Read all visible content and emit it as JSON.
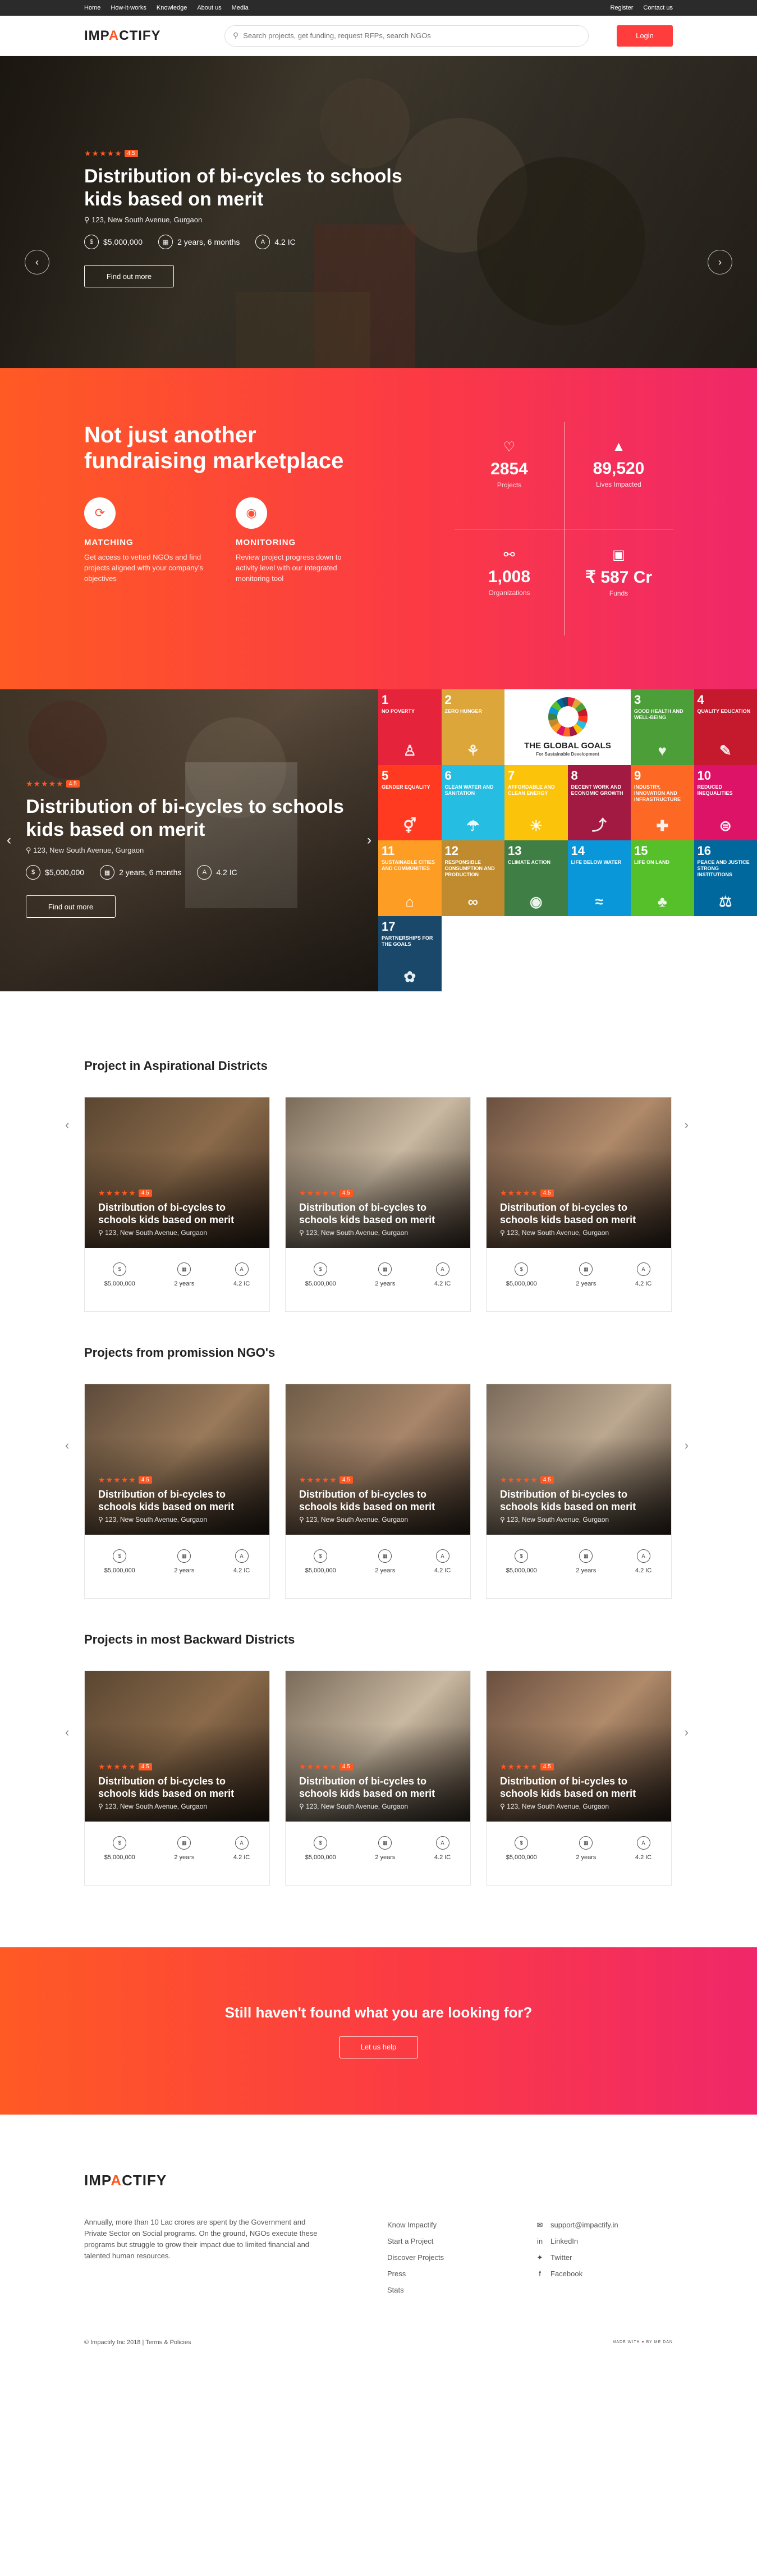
{
  "topbar": {
    "left": [
      "Home",
      "How-it-works",
      "Knowledge",
      "About us",
      "Media"
    ],
    "right": [
      "Register",
      "Contact us"
    ]
  },
  "header": {
    "logo_pre": "IMP",
    "logo_accent": "A",
    "logo_post": "CTIFY",
    "search_placeholder": "Search projects, get funding, request RFPs, search NGOs",
    "login_label": "Login"
  },
  "hero": {
    "rating": "4.5",
    "stars": "★★★★★",
    "title": "Distribution of bi-cycles to schools kids based on merit",
    "location": "123, New South Avenue, Gurgaon",
    "budget": "$5,000,000",
    "duration": "2 years, 6 months",
    "ic": "4.2 IC",
    "cta": "Find out more"
  },
  "marketplace": {
    "title": "Not just another fundraising marketplace",
    "features": [
      {
        "title": "MATCHING",
        "desc": "Get access to vetted NGOs and find projects aligned with your company's objectives"
      },
      {
        "title": "MONITORING",
        "desc": "Review project progress down to activity level with our integrated monitoring tool"
      }
    ],
    "stats": [
      {
        "value": "2854",
        "label": "Projects"
      },
      {
        "value": "89,520",
        "label": "Lives Impacted"
      },
      {
        "value": "1,008",
        "label": "Organizations"
      },
      {
        "value": "₹ 587 Cr",
        "label": "Funds"
      }
    ]
  },
  "split_feature": {
    "rating": "4.5",
    "title": "Distribution of bi-cycles to schools kids based on merit",
    "location": "123, New South Avenue, Gurgaon",
    "budget": "$5,000,000",
    "duration": "2 years, 6 months",
    "ic": "4.2 IC",
    "cta": "Find out more"
  },
  "sdg": {
    "logo_title": "THE GLOBAL GOALS",
    "logo_sub": "For Sustainable Development",
    "tiles": [
      {
        "num": "1",
        "label": "NO POVERTY",
        "color": "#e5243b"
      },
      {
        "num": "2",
        "label": "ZERO HUNGER",
        "color": "#dda63a"
      },
      {
        "num": "",
        "label": "",
        "color": "#000000"
      },
      {
        "num": "3",
        "label": "GOOD HEALTH AND WELL-BEING",
        "color": "#4c9f38"
      },
      {
        "num": "4",
        "label": "QUALITY EDUCATION",
        "color": "#c5192d"
      },
      {
        "num": "5",
        "label": "GENDER EQUALITY",
        "color": "#ff3a21"
      },
      {
        "num": "6",
        "label": "CLEAN WATER AND SANITATION",
        "color": "#26bde2"
      },
      {
        "num": "7",
        "label": "AFFORDABLE AND CLEAN ENERGY",
        "color": "#fcc30b"
      },
      {
        "num": "8",
        "label": "DECENT WORK AND ECONOMIC GROWTH",
        "color": "#a21942"
      },
      {
        "num": "9",
        "label": "INDUSTRY, INNOVATION AND INFRASTRUCTURE",
        "color": "#fd6925"
      },
      {
        "num": "10",
        "label": "REDUCED INEQUALITIES",
        "color": "#dd1367"
      },
      {
        "num": "11",
        "label": "SUSTAINABLE CITIES AND COMMUNITIES",
        "color": "#fd9d24"
      },
      {
        "num": "12",
        "label": "RESPONSIBLE CONSUMPTION AND PRODUCTION",
        "color": "#bf8b2e"
      },
      {
        "num": "13",
        "label": "CLIMATE ACTION",
        "color": "#3f7e44"
      },
      {
        "num": "14",
        "label": "LIFE BELOW WATER",
        "color": "#0a97d9"
      },
      {
        "num": "15",
        "label": "LIFE ON LAND",
        "color": "#56c02b"
      },
      {
        "num": "16",
        "label": "PEACE AND JUSTICE STRONG INSTITUTIONS",
        "color": "#00689d"
      },
      {
        "num": "17",
        "label": "PARTNERSHIPS FOR THE GOALS",
        "color": "#19486a"
      }
    ]
  },
  "sections": [
    {
      "title": "Project in Aspirational Districts",
      "cards": [
        {
          "rating": "4.5",
          "title": "Distribution of bi-cycles to schools kids based on merit",
          "location": "123, New South Avenue, Gurgaon",
          "budget": "$5,000,000",
          "duration": "2 years",
          "ic": "4.2 IC"
        },
        {
          "rating": "4.5",
          "title": "Distribution of bi-cycles to schools kids based on merit",
          "location": "123, New South Avenue, Gurgaon",
          "budget": "$5,000,000",
          "duration": "2 years",
          "ic": "4.2 IC"
        },
        {
          "rating": "4.5",
          "title": "Distribution of bi-cycles to schools kids based on merit",
          "location": "123, New South Avenue, Gurgaon",
          "budget": "$5,000,000",
          "duration": "2 years",
          "ic": "4.2 IC"
        }
      ]
    },
    {
      "title": "Projects from promission NGO's",
      "cards": [
        {
          "rating": "4.5",
          "title": "Distribution of bi-cycles to schools kids based on merit",
          "location": "123, New South Avenue, Gurgaon",
          "budget": "$5,000,000",
          "duration": "2 years",
          "ic": "4.2 IC"
        },
        {
          "rating": "4.5",
          "title": "Distribution of bi-cycles to schools kids based on merit",
          "location": "123, New South Avenue, Gurgaon",
          "budget": "$5,000,000",
          "duration": "2 years",
          "ic": "4.2 IC"
        },
        {
          "rating": "4.5",
          "title": "Distribution of bi-cycles to schools kids based on merit",
          "location": "123, New South Avenue, Gurgaon",
          "budget": "$5,000,000",
          "duration": "2 years",
          "ic": "4.2 IC"
        }
      ]
    },
    {
      "title": "Projects in most Backward Districts",
      "cards": [
        {
          "rating": "4.5",
          "title": "Distribution of bi-cycles to schools kids based on merit",
          "location": "123, New South Avenue, Gurgaon",
          "budget": "$5,000,000",
          "duration": "2 years",
          "ic": "4.2 IC"
        },
        {
          "rating": "4.5",
          "title": "Distribution of bi-cycles to schools kids based on merit",
          "location": "123, New South Avenue, Gurgaon",
          "budget": "$5,000,000",
          "duration": "2 years",
          "ic": "4.2 IC"
        },
        {
          "rating": "4.5",
          "title": "Distribution of bi-cycles to schools kids based on merit",
          "location": "123, New South Avenue, Gurgaon",
          "budget": "$5,000,000",
          "duration": "2 years",
          "ic": "4.2 IC"
        }
      ]
    }
  ],
  "cta": {
    "title": "Still haven't found what you are looking for?",
    "button": "Let us help"
  },
  "footer": {
    "description": "Annually, more than 10 Lac crores are spent by the Government and Private Sector on Social programs. On the ground, NGOs execute these programs but struggle to grow their impact due to limited financial and talented human resources.",
    "links": [
      "Know Impactify",
      "Start a Project",
      "Discover Projects",
      "Press",
      "Stats"
    ],
    "contact": [
      {
        "icon": "mail-icon",
        "label": "support@impactify.in"
      },
      {
        "icon": "linkedin-icon",
        "label": "LinkedIn"
      },
      {
        "icon": "twitter-icon",
        "label": "Twitter"
      },
      {
        "icon": "facebook-icon",
        "label": "Facebook"
      }
    ],
    "copyright": "© Impactify Inc 2018 | Terms & Policies",
    "made_pre": "MADE WITH",
    "made_post": "BY ME DAN"
  }
}
